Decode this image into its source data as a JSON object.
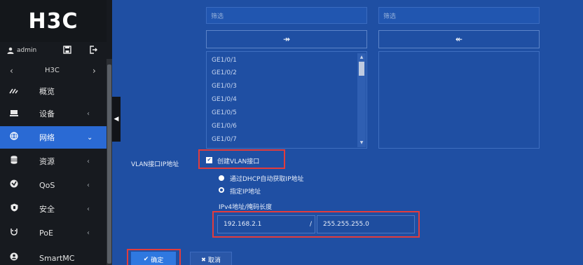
{
  "brand": {
    "logo_text": "H3C"
  },
  "user": {
    "name": "admin",
    "user_icon": "user-icon",
    "icons": [
      "save-icon",
      "logout-icon"
    ]
  },
  "device_switcher": {
    "device": "H3C",
    "prev": "‹",
    "next": "›"
  },
  "nav": {
    "items": [
      {
        "label": "概览",
        "icon": "dashboard-icon",
        "chevron": ""
      },
      {
        "label": "设备",
        "icon": "device-icon",
        "chevron": "‹"
      },
      {
        "label": "网络",
        "icon": "globe-icon",
        "chevron": "⌄"
      },
      {
        "label": "资源",
        "icon": "database-icon",
        "chevron": "‹"
      },
      {
        "label": "QoS",
        "icon": "qos-icon",
        "chevron": "‹"
      },
      {
        "label": "安全",
        "icon": "shield-icon",
        "chevron": "‹"
      },
      {
        "label": "PoE",
        "icon": "poe-icon",
        "chevron": "‹"
      },
      {
        "label": "SmartMC",
        "icon": "smartmc-icon",
        "chevron": ""
      }
    ],
    "active_index": 2
  },
  "filters": {
    "left_placeholder": "筛选",
    "right_placeholder": "筛选"
  },
  "move_buttons": {
    "add": "↠",
    "remove": "↞"
  },
  "port_list": [
    "GE1/0/1",
    "GE1/0/2",
    "GE1/0/3",
    "GE1/0/4",
    "GE1/0/5",
    "GE1/0/6",
    "GE1/0/7"
  ],
  "vlan_form": {
    "field_label": "VLAN接口IP地址",
    "create_checkbox_label": "创建VLAN接口",
    "create_checked": true,
    "dhcp_option": "通过DHCP自动获取IP地址",
    "static_option": "指定IP地址",
    "selected_option": "static",
    "ip_mask_label": "IPv4地址/掩码长度",
    "ip_value": "192.168.2.1",
    "separator": "/",
    "mask_value": "255.255.255.0"
  },
  "actions": {
    "ok": "确定",
    "ok_icon": "✔",
    "cancel": "取消",
    "cancel_icon": "✖"
  },
  "colors": {
    "main_bg": "#1f4fa3",
    "sidebar_bg": "#171a1f",
    "active_nav": "#2a6ad4",
    "highlight_red": "#e23c3c"
  }
}
